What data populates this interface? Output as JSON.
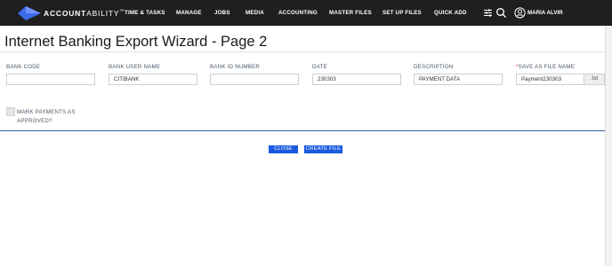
{
  "brand": {
    "name_bold": "ACCOUNT",
    "name_light": "ABILITY",
    "trademark": "™",
    "accent": "#3d6bea"
  },
  "nav": {
    "items": [
      "TIME & TASKS",
      "MANAGE",
      "JOBS",
      "MEDIA",
      "ACCOUNTING",
      "MASTER FILES",
      "SET UP FILES",
      "QUICK ADD"
    ],
    "icons": [
      "sliders-icon",
      "search-icon",
      "user-icon"
    ],
    "user": "MARIA ALVIR"
  },
  "page": {
    "title": "Internet Banking Export Wizard - Page 2"
  },
  "form": {
    "fields": [
      {
        "label": "BANK CODE",
        "value": ""
      },
      {
        "label": "BANK USER NAME",
        "value": "CITIBANK"
      },
      {
        "label": "BANK ID NUMBER",
        "value": ""
      },
      {
        "label": "DATE",
        "value": "230303"
      },
      {
        "label": "DESCRIPTION",
        "value": "PAYMENT DATA"
      },
      {
        "label": "SAVE AS FILE NAME",
        "value": "Payment230303",
        "required_mark": "*",
        "suffix": ".txt"
      }
    ],
    "checkbox": {
      "label": "MARK PAYMENTS AS APPROVED?",
      "checked": false
    }
  },
  "actions": {
    "close": "CLOSE",
    "create": "CREATE FILE"
  },
  "colors": {
    "topbar": "#1f1f1f",
    "button": "#1a5ae0",
    "rule": "#2f5f9e",
    "required": "#e0301e"
  }
}
